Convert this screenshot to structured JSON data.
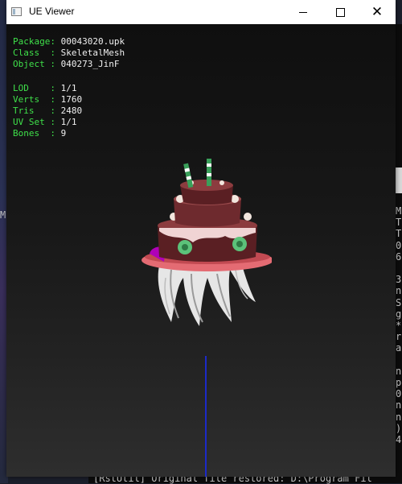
{
  "background": {
    "left_fragment": "M",
    "right_fragments": [
      "M",
      "T",
      "T",
      "0",
      "6",
      "",
      "3",
      "n",
      "S",
      "g",
      "*",
      "r",
      "a",
      "",
      "n",
      "p",
      "0",
      "n",
      "n",
      ")",
      "4"
    ],
    "bottom_text": "[RstUtil] Original file restored: D:\\Program Fil"
  },
  "window": {
    "title": "UE Viewer",
    "icon": "app-window-icon",
    "controls": {
      "minimize": "minimize-icon",
      "maximize": "maximize-icon",
      "close": "close-icon"
    }
  },
  "info_block_1": [
    {
      "label": "Package",
      "sep": ": ",
      "value": "00043020.upk"
    },
    {
      "label": "Class  ",
      "sep": ": ",
      "value": "SkeletalMesh"
    },
    {
      "label": "Object ",
      "sep": ": ",
      "value": "040273_JinF"
    }
  ],
  "info_block_2": [
    {
      "label": "LOD    ",
      "sep": ": ",
      "value": "1/1"
    },
    {
      "label": "Verts  ",
      "sep": ": ",
      "value": "1760"
    },
    {
      "label": "Tris   ",
      "sep": ": ",
      "value": "2480"
    },
    {
      "label": "UV Set ",
      "sep": ": ",
      "value": "1/1"
    },
    {
      "label": "Bones  ",
      "sep": ": ",
      "value": "9"
    }
  ],
  "colors": {
    "label": "#3fe04a",
    "value": "#f0f0f0",
    "axis": "#1c2ac8",
    "cake_base": "#5a1f23",
    "hat_brim": "#e46b73"
  }
}
